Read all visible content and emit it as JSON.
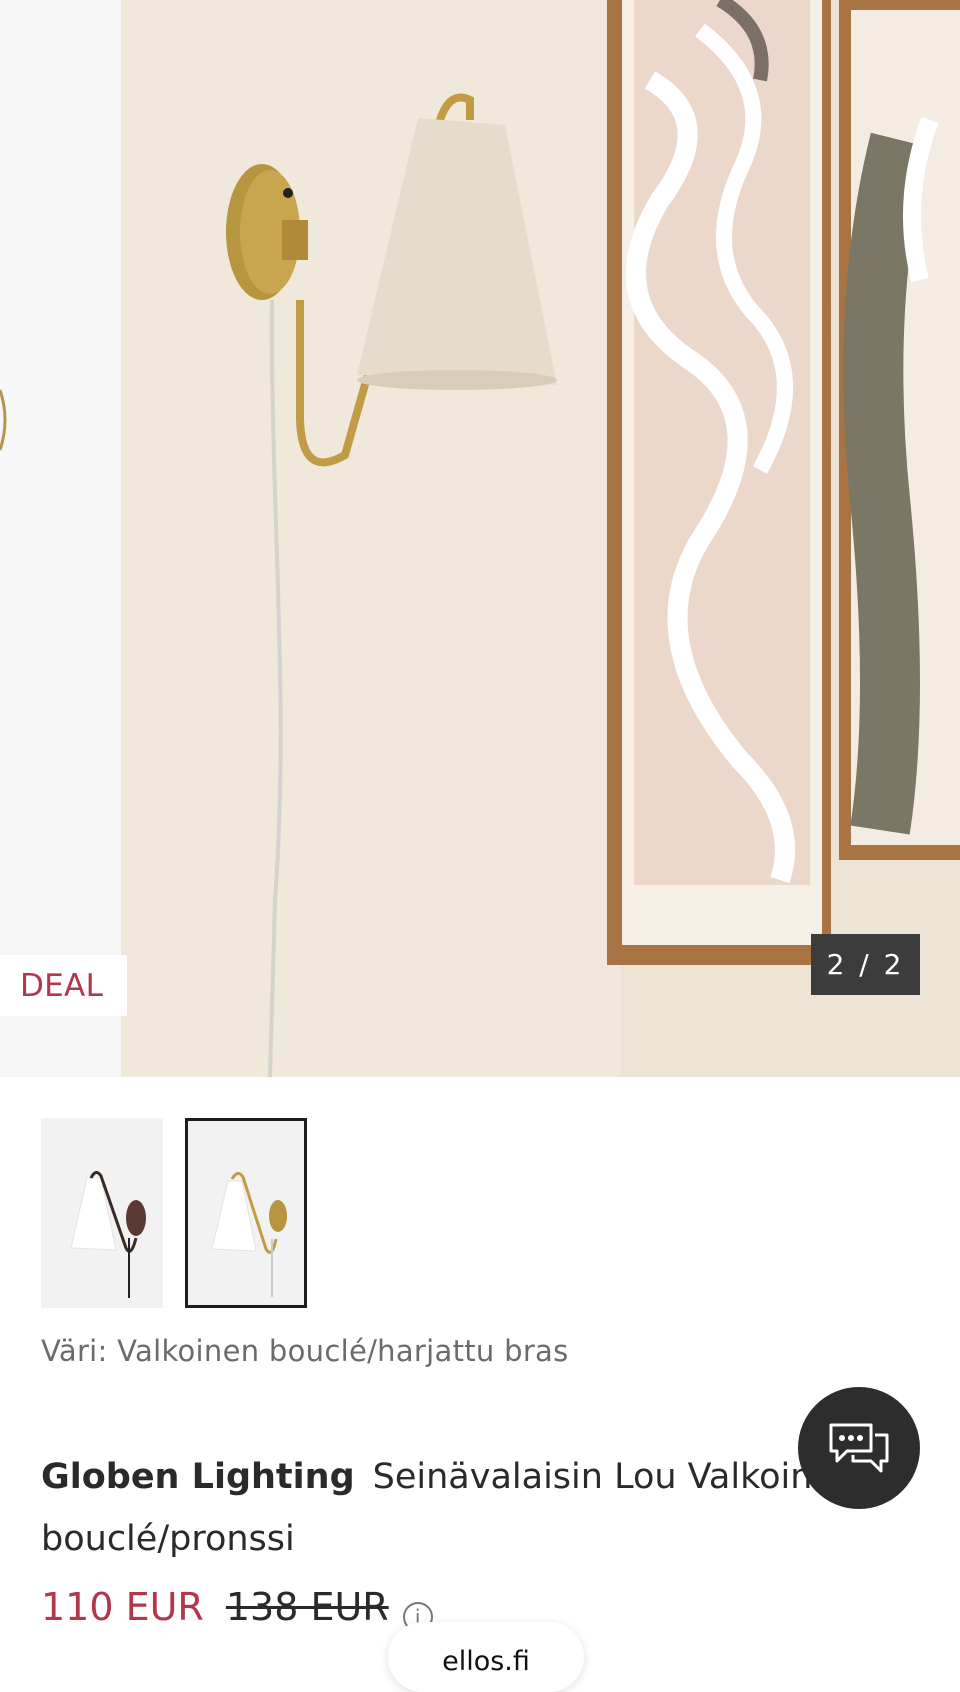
{
  "gallery": {
    "deal_label": "DEAL",
    "counter": "2 / 2",
    "main_image": "wall-lamp-photo",
    "thumbnails": [
      {
        "name": "thumbnail-white-dark",
        "selected": false
      },
      {
        "name": "thumbnail-white-brass",
        "selected": true
      }
    ]
  },
  "product": {
    "color_text": "Väri: Valkoinen bouclé/harjattu bras",
    "brand": "Globen Lighting",
    "name": "Seinävalaisin Lou Valkoinen bouclé/pronssi",
    "price_now": "110 EUR",
    "price_old": "138 EUR",
    "info_icon": "info-icon"
  },
  "chat": {
    "icon": "chat-bubbles-icon"
  },
  "browser": {
    "domain": "ellos.fi"
  },
  "colors": {
    "accent": "#b3374b",
    "counter_bg": "#3c3c3c",
    "chat_bg": "#2d2d2d"
  }
}
